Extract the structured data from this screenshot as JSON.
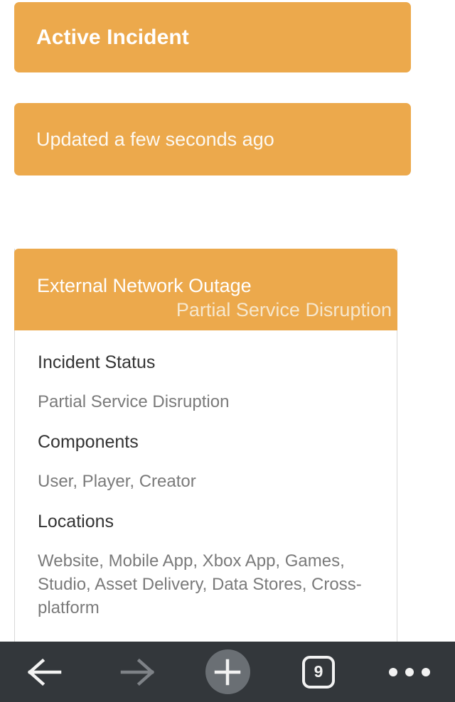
{
  "banners": {
    "active_incident": "Active Incident",
    "updated": "Updated a few seconds ago"
  },
  "incident_card": {
    "header": {
      "title": "External Network Outage",
      "subtitle": "Partial Service Disruption"
    },
    "fields": [
      {
        "label": "Incident Status",
        "value": "Partial Service Disruption"
      },
      {
        "label": "Components",
        "value": "User, Player, Creator"
      },
      {
        "label": "Locations",
        "value": "Website, Mobile App, Xbox App, Games, Studio, Asset Delivery, Data Stores, Cross-platform"
      }
    ]
  },
  "toolbar": {
    "back_label": "Back",
    "forward_label": "Forward",
    "new_tab_label": "New Tab",
    "tab_count": "9",
    "menu_label": "More options"
  },
  "colors": {
    "accent_orange": "#eca94c",
    "banner_text": "#ffffff",
    "subtitle_text": "#f6e7cd",
    "heading_text": "#333333",
    "value_text": "#7a7a7a",
    "card_border": "#d8d8d8",
    "toolbar_background": "#33373b",
    "toolbar_icon": "#f2f2f2",
    "toolbar_icon_disabled": "#7e8287",
    "new_tab_circle": "#6a6f74"
  }
}
